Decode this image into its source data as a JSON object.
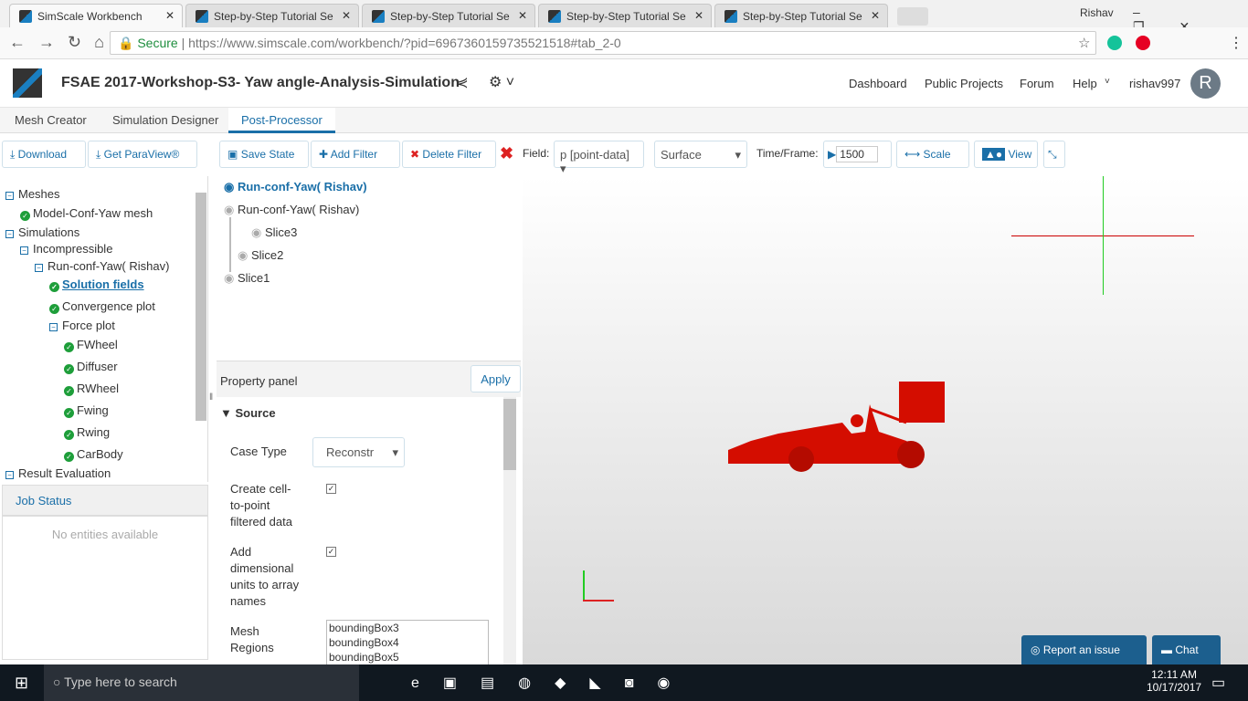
{
  "browser": {
    "tabs": [
      "SimScale Workbench",
      "Step-by-Step Tutorial Se",
      "Step-by-Step Tutorial Se",
      "Step-by-Step Tutorial Se",
      "Step-by-Step Tutorial Se"
    ],
    "user": "Rishav",
    "secure": "Secure",
    "url": "https://www.simscale.com/workbench/?pid=6967360159735521518#tab_2-0"
  },
  "header": {
    "title": "FSAE 2017-Workshop-S3- Yaw angle-Analysis-Simulation",
    "nav": [
      "Dashboard",
      "Public Projects",
      "Forum",
      "Help"
    ],
    "username": "rishav997",
    "avatar": "R"
  },
  "subnav": [
    "Mesh Creator",
    "Simulation Designer",
    "Post-Processor"
  ],
  "left_toolbar": {
    "download": "Download",
    "paraview": "Get ParaView®"
  },
  "toolbar": {
    "save": "Save State",
    "add": "Add Filter",
    "delete": "Delete Filter",
    "field_label": "Field:",
    "field": "p [point-data]",
    "repr": "Surface",
    "time_label": "Time/Frame:",
    "frame": "1500",
    "scale": "Scale",
    "view": "View"
  },
  "tree": [
    "Meshes",
    "Model-Conf-Yaw mesh",
    "Simulations",
    "Incompressible",
    "Run-conf-Yaw( Rishav)",
    "Solution fields",
    "Convergence plot",
    "Force plot",
    "FWheel",
    "Diffuser",
    "RWheel",
    "Fwing",
    "Rwing",
    "CarBody",
    "Result Evaluation"
  ],
  "job_status": {
    "title": "Job Status",
    "empty": "No entities available"
  },
  "pipeline": {
    "root": "Run-conf-Yaw( Rishav)",
    "items": [
      "Run-conf-Yaw( Rishav)",
      "Slice3",
      "Slice2",
      "Slice1"
    ]
  },
  "property": {
    "title": "Property panel",
    "apply": "Apply",
    "section": "Source",
    "case_type_label": "Case Type",
    "case_type": "Reconstr",
    "cell_label": "Create cell-to-point filtered data",
    "units_label": "Add dimensional units to array names",
    "regions_label": "Mesh Regions",
    "regions": [
      "boundingBox3",
      "boundingBox4",
      "boundingBox5"
    ]
  },
  "actions": {
    "report": "Report an issue",
    "chat": "Chat"
  },
  "taskbar": {
    "search": "Type here to search",
    "time": "12:11 AM",
    "date": "10/17/2017"
  }
}
